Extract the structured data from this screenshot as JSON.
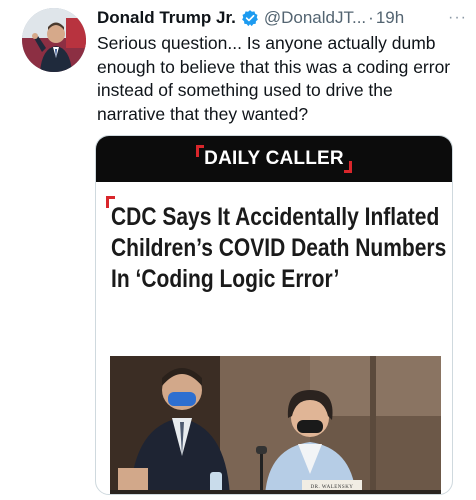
{
  "tweet": {
    "display_name": "Donald Trump Jr.",
    "handle": "@DonaldJT...",
    "separator": "·",
    "time": "19h",
    "more_label": "···",
    "verified_icon": "verified-badge-icon",
    "text": "Serious question... Is anyone actually dumb enough to believe that this was a coding error instead of something used to drive the narrative that they wanted?"
  },
  "card": {
    "source": "DAILY CALLER",
    "headline": "CDC Says It Accidentally Inflated Children’s COVID Death Numbers In ‘Coding Logic Error’",
    "nameplate": "DR. WALENSKY"
  },
  "colors": {
    "verified": "#1d9bf0",
    "brand_red": "#d9262b",
    "banner_bg": "#0c0c0c",
    "muted_text": "#536471"
  }
}
